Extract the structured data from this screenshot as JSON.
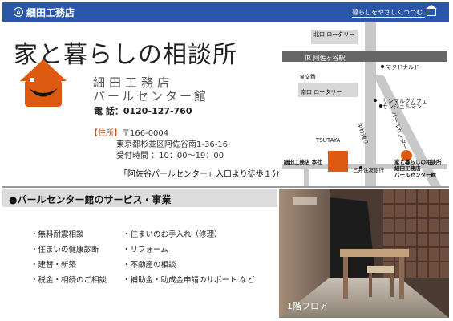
{
  "header": {
    "brand": "細田工務店",
    "tagline": "暮らしをやさしくつつむ"
  },
  "main": {
    "title": "家と暮らしの相談所",
    "office_name": "細田工務店",
    "office_sub": "パールセンター館",
    "tel_label": "電",
    "tel_text": "話：0120-127-760",
    "address_label": "【住所】",
    "postal": "〒166-0004",
    "address": "東京都杉並区阿佐谷南1-36-16",
    "hours": "受付時間 ：10：00～19：00",
    "access": "「阿佐谷パールセンター」入口より徒歩１分"
  },
  "map": {
    "north_rotary": "北口 ロータリー",
    "station": "JR 阿佐ヶ谷駅",
    "mcdonalds": "マクドナルド",
    "police": "交番",
    "south_rotary": "南口 ロータリー",
    "sunmarc": "サンマルクカフェ",
    "sanjie": "サンジェルマン",
    "nakasugi": "中杉通り",
    "pearl_center": "パールセンター",
    "tsutaya": "TSUTAYA",
    "hq": "細田工務店 本社",
    "bank": "三井住友銀行",
    "shop_name": "家と暮らしの相談所",
    "shop_branch": "細田工務店",
    "shop_building": "パールセンター館",
    "colors": {
      "accent": "#dd5a10",
      "road": "#c8c8c8",
      "station": "#666666"
    }
  },
  "services": {
    "heading": "●パールセンター館のサービス・事業",
    "left": [
      "・無料耐震相談",
      "・住まいの健康診断",
      "・建替・新築",
      "・税金・相続のご相談"
    ],
    "right": [
      "・住まいのお手入れ（修理）",
      "・リフォーム",
      "・不動産の相談",
      "・補助金・助成金申請のサポート など"
    ]
  },
  "photo": {
    "caption": "1階フロア"
  },
  "colors": {
    "header_blue": "#2a56a8",
    "accent_orange": "#dd5a10",
    "band_gray": "#dcdcdc"
  },
  "icons": [
    "brand-logo-icon",
    "house-smile-logo",
    "house-tag-icon"
  ]
}
